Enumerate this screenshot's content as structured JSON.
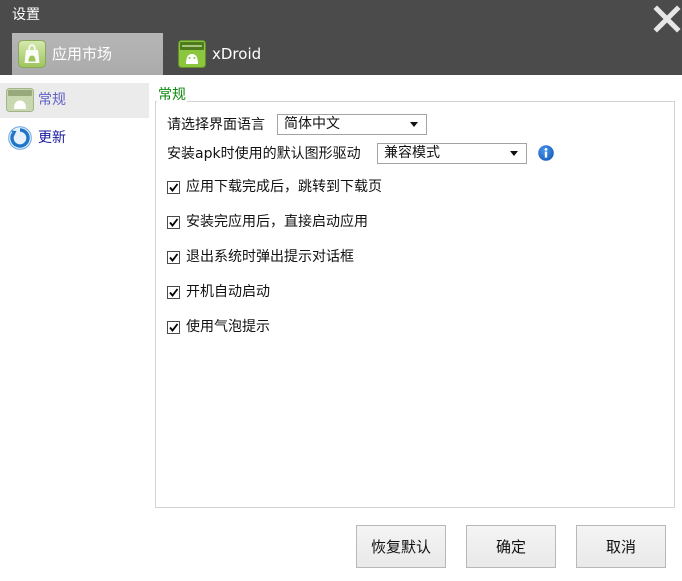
{
  "window": {
    "title": "设置",
    "close_icon": "close-icon"
  },
  "tabs": [
    {
      "label": "应用市场",
      "icon": "app-market-icon",
      "active": true
    },
    {
      "label": "xDroid",
      "icon": "xdroid-icon",
      "active": false
    }
  ],
  "sidebar": {
    "items": [
      {
        "label": "常规",
        "icon": "general-settings-icon",
        "selected": true
      },
      {
        "label": "更新",
        "icon": "update-icon",
        "selected": false
      }
    ]
  },
  "general": {
    "group_title": "常规",
    "language": {
      "label": "请选择界面语言",
      "value": "简体中文"
    },
    "graphics_driver": {
      "label": "安装apk时使用的默认图形驱动",
      "value": "兼容模式",
      "info_icon": "info-icon"
    },
    "options": [
      {
        "label": "应用下载完成后，跳转到下载页",
        "checked": true
      },
      {
        "label": "安装完应用后，直接启动应用",
        "checked": true
      },
      {
        "label": "退出系统时弹出提示对话框",
        "checked": true
      },
      {
        "label": "开机自动启动",
        "checked": true
      },
      {
        "label": "使用气泡提示",
        "checked": true
      }
    ]
  },
  "buttons": {
    "restore_defaults": "恢复默认",
    "ok": "确定",
    "cancel": "取消"
  },
  "colors": {
    "header_background": "#4b4b4b",
    "active_tab": "#ababab",
    "group_title": "#0a8a0a",
    "sidebar_selected_text": "#6060c8",
    "sidebar_text": "#1a1aa0",
    "sidebar_selected_background": "#ebebeb",
    "info_icon": "#1a6fd6"
  }
}
